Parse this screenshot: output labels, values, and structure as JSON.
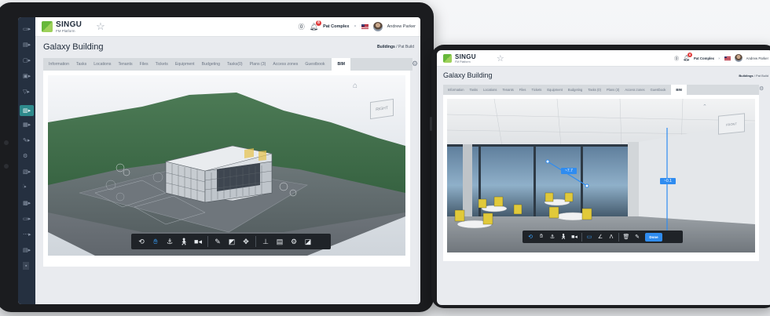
{
  "brand": {
    "name": "SINGU",
    "subtitle": "FM Platform"
  },
  "left_app": {
    "page_title": "Galaxy Building",
    "breadcrumb_parent": "Buildings",
    "breadcrumb_sep": " / ",
    "breadcrumb_current": "Pat Build",
    "org": "Pat Complex",
    "org_close": "×",
    "user": "Andrew Parker",
    "notification_count": "8",
    "tabs": [
      "Information",
      "Tasks",
      "Locations",
      "Tenants",
      "Files",
      "Tickets",
      "Equipment",
      "Budgeting",
      "Tasks(0)",
      "Plans (3)",
      "Access zones",
      "Guestbook",
      "BIM"
    ],
    "active_tab": "BIM",
    "cube_label": "RIGHT"
  },
  "right_app": {
    "page_title": "Galaxy Building",
    "breadcrumb_parent": "Buildings",
    "breadcrumb_sep": " / ",
    "breadcrumb_current": "Pat Build",
    "org": "Pat Complex",
    "org_close": "×",
    "user": "Andrew Parker",
    "notification_count": "8",
    "tabs": [
      "Information",
      "Tasks",
      "Locations",
      "Tenants",
      "Files",
      "Tickets",
      "Equipment",
      "Budgeting",
      "Tasks (0)",
      "Plans (3)",
      "Access zones",
      "Guestbook",
      "BIM"
    ],
    "active_tab": "BIM",
    "cube_label": "FRONT",
    "measure_1": "~7.7",
    "measure_2": "~0.1",
    "done_label": "Done"
  },
  "colors": {
    "sidebar": "#253040",
    "accent": "#2e8a8c",
    "brand_green": "#67b83b",
    "measure_blue": "#2f8cf0",
    "toolbar": "#1f2328"
  },
  "icons": {
    "toolbar_left": [
      "orbit-icon",
      "pan-icon",
      "anchor-icon",
      "walk-icon",
      "camera-icon",
      "measure-icon",
      "section-icon",
      "explode-icon",
      "model-tree-icon",
      "properties-icon",
      "settings-icon",
      "fullscreen-icon"
    ],
    "toolbar_right": [
      "orbit-icon",
      "pan-icon",
      "anchor-icon",
      "walk-icon",
      "camera-icon",
      "distance-icon",
      "angle-icon",
      "area-icon",
      "delete-icon",
      "calibrate-icon"
    ]
  }
}
